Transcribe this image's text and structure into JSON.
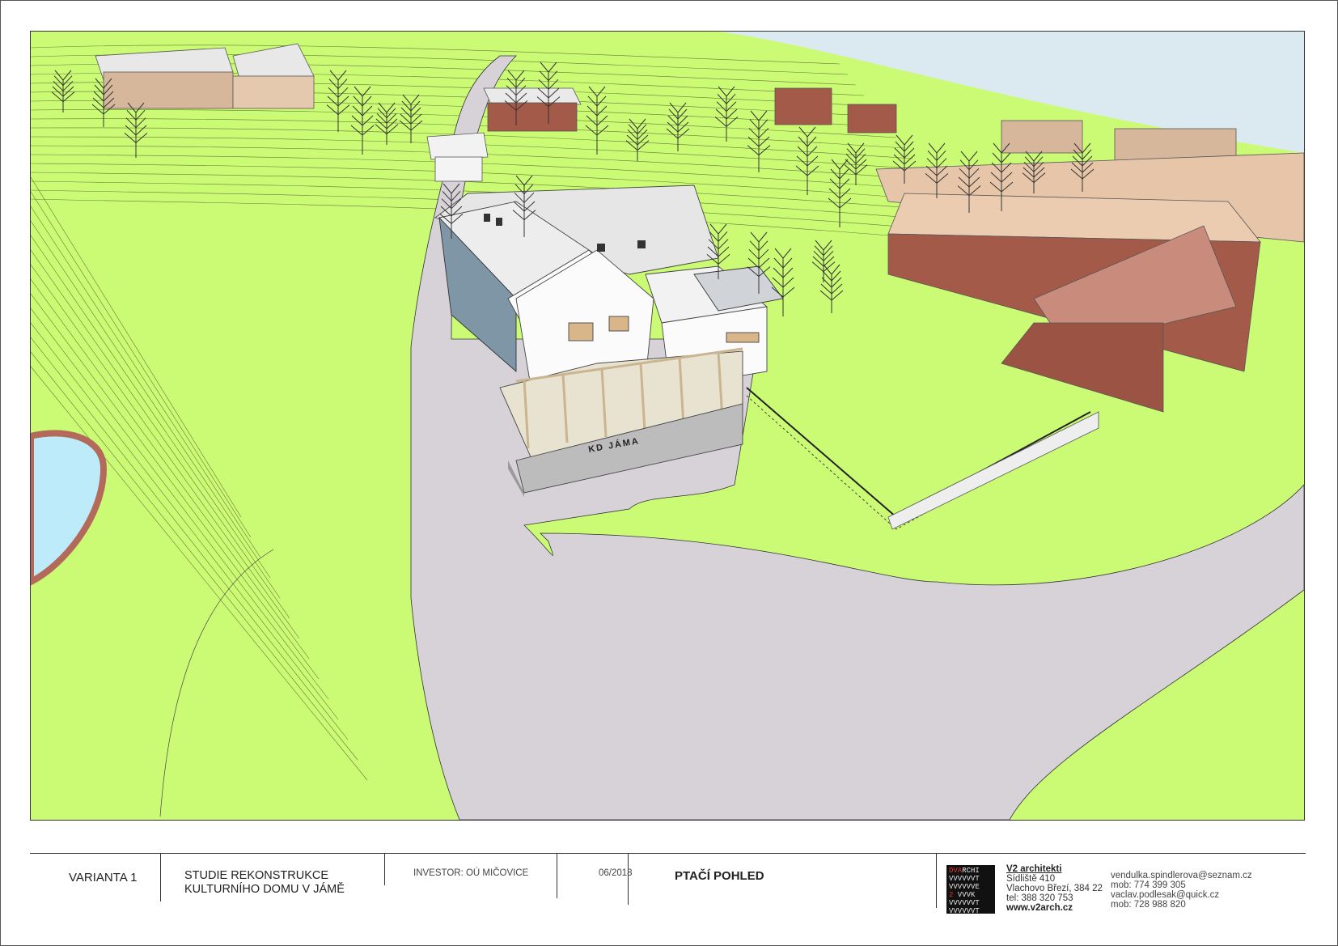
{
  "drawing": {
    "sign_text": "KD JÁMA"
  },
  "titleblock": {
    "variant": "VARIANTA 1",
    "study_line1": "STUDIE REKONSTRUKCE",
    "study_line2": "KULTURNÍHO DOMU V JÁMĚ",
    "investor": "INVESTOR: OÚ MIČOVICE",
    "date": "06/2018",
    "view_title": "PTAČÍ POHLED",
    "logo_rows": [
      "DVARCHI",
      "VVVVVVT",
      "VVVVVVE",
      "2 VVVK",
      "VVVVVVT",
      "VVVVVVT"
    ],
    "studio": {
      "name": "V2 architekti",
      "address1": "Sídliště 410",
      "address2": "Vlachovo Březí, 384 22",
      "phone": "tel: 388 320 753",
      "web": "www.v2arch.cz"
    },
    "contacts": [
      "vendulka.spindlerova@seznam.cz",
      "mob: 774 399 305",
      "vaclav.podlesak@quick.cz",
      "mob: 728 988 820"
    ]
  },
  "colors": {
    "grass": "#cbfb74",
    "road": "#d6d2d8",
    "roof": "#e6e6e6",
    "wall": "#fbfbfb",
    "brick": "#a45a48",
    "tan": "#d7b79c",
    "water": "#bdebfa",
    "sky": "#dbe9f1"
  }
}
